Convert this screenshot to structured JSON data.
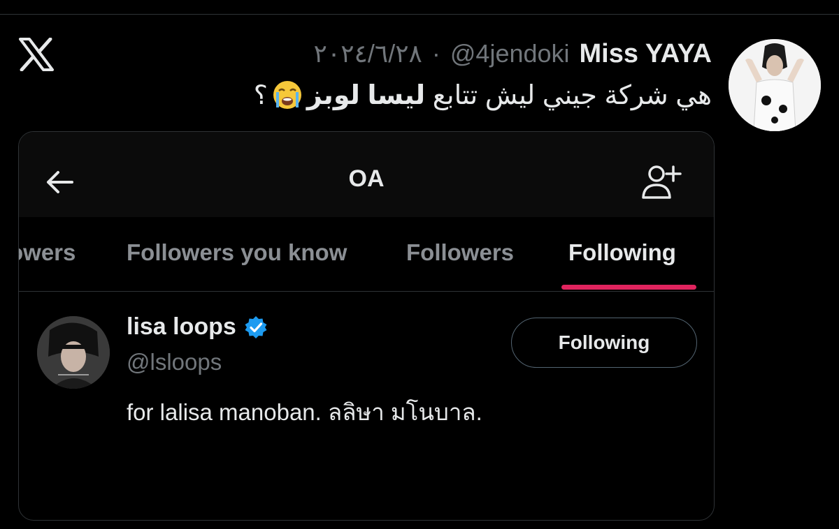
{
  "tweet": {
    "author_name": "Miss YAYA",
    "handle": "@4jendoki",
    "date": "٢٠٢٤/٦/٢٨",
    "separator": "·",
    "text_prefix": "هي شركة جيني ليش تتابع",
    "text_bold": "ليسا لوبز",
    "text_suffix": "؟",
    "emoji": "loudly-crying-face"
  },
  "embedded": {
    "title": "OA",
    "tabs": [
      "owers",
      "Followers you know",
      "Followers",
      "Following"
    ],
    "active_tab": "Following",
    "accent_color": "#e0245e",
    "user": {
      "name": "lisa loops",
      "handle": "@lsloops",
      "bio": "for lalisa manoban. ลลิษา มโนบาล.",
      "verified": true,
      "verified_color": "#1d9bf0",
      "button_label": "Following"
    }
  }
}
